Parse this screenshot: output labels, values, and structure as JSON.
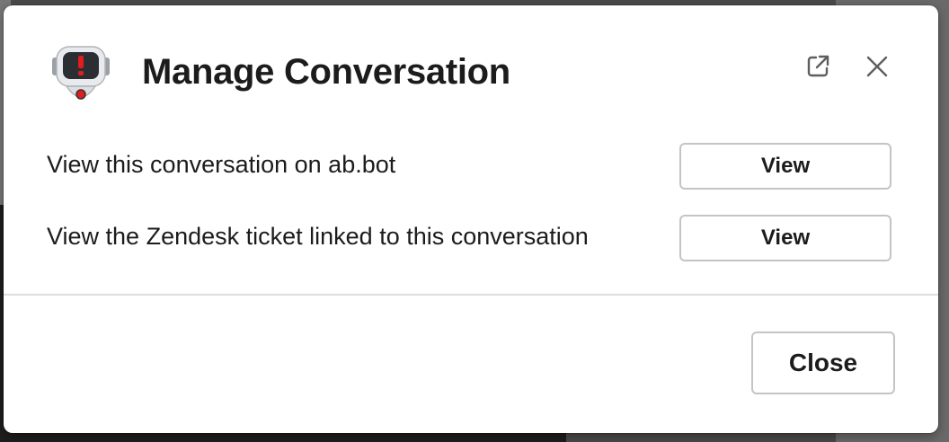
{
  "modal": {
    "title": "Manage Conversation",
    "header_icons": {
      "app_icon": "robot-alert-icon",
      "open_external": "external-link-icon",
      "close": "close-icon"
    }
  },
  "rows": [
    {
      "label": "View this conversation on ab.bot",
      "button_label": "View"
    },
    {
      "label": "View the Zendesk ticket linked to this conversation",
      "button_label": "View"
    }
  ],
  "footer": {
    "close_label": "Close"
  },
  "colors": {
    "text": "#1d1c1d",
    "button_border": "#c4c4c4",
    "divider": "#dddddd",
    "alert_red": "#e01e1e"
  }
}
